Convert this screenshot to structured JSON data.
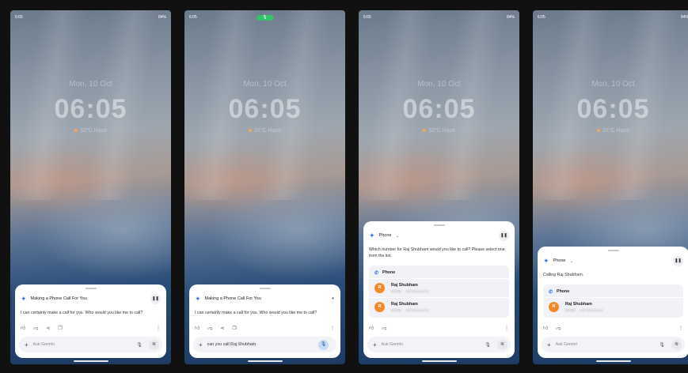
{
  "lockscreen": {
    "status_time": "6:05",
    "battery": "84%",
    "date": "Mon, 10 Oct",
    "clock": "06:05",
    "weather": "32°C Haze"
  },
  "screens": [
    {
      "header": "Making a Phone Call For You",
      "message": "I can certainly make a call for you. Who would you like me to call?",
      "input_placeholder": "Ask Gemini",
      "header_control": "pause"
    },
    {
      "header": "Making a Phone Call For You",
      "message": "I can certainly make a call for you. Who would you like me to call?",
      "input_text": "can you call Raj Shubham",
      "header_control": "speaker"
    },
    {
      "header": "Phone",
      "message": "Which number for Raj Shubham would you like to call? Please select one from the list.",
      "section_label": "Phone",
      "contacts": [
        {
          "initial": "R",
          "name": "Raj Shubham",
          "number": "Mobile · +9179xxxxxxxx"
        },
        {
          "initial": "R",
          "name": "Raj Shubham",
          "number": "Mobile · +9179xxxxxxxx"
        }
      ],
      "input_placeholder": "Ask Gemini",
      "header_control": "pause"
    },
    {
      "header": "Phone",
      "message": "Calling Raj Shubham.",
      "section_label": "Phone",
      "contacts": [
        {
          "initial": "R",
          "name": "Raj Shubham",
          "number": "Mobile · +9179xxxxxxxx"
        }
      ],
      "input_placeholder": "Ask Gemini",
      "header_control": "pause"
    }
  ],
  "icons": {
    "gemini": "gemini-sparkle-icon",
    "pause": "pause-icon",
    "speaker": "speaker-icon",
    "thumbs_up": "thumbs-up-icon",
    "thumbs_down": "thumbs-down-icon",
    "share": "share-icon",
    "copy": "copy-icon",
    "more": "more-vert-icon",
    "plus": "plus-icon",
    "mic": "mic-icon",
    "live": "live-icon",
    "phone": "phone-icon"
  },
  "colors": {
    "accent": "#3b78e7",
    "avatar": "#f28a2c",
    "mic_active": "#34c36a"
  }
}
